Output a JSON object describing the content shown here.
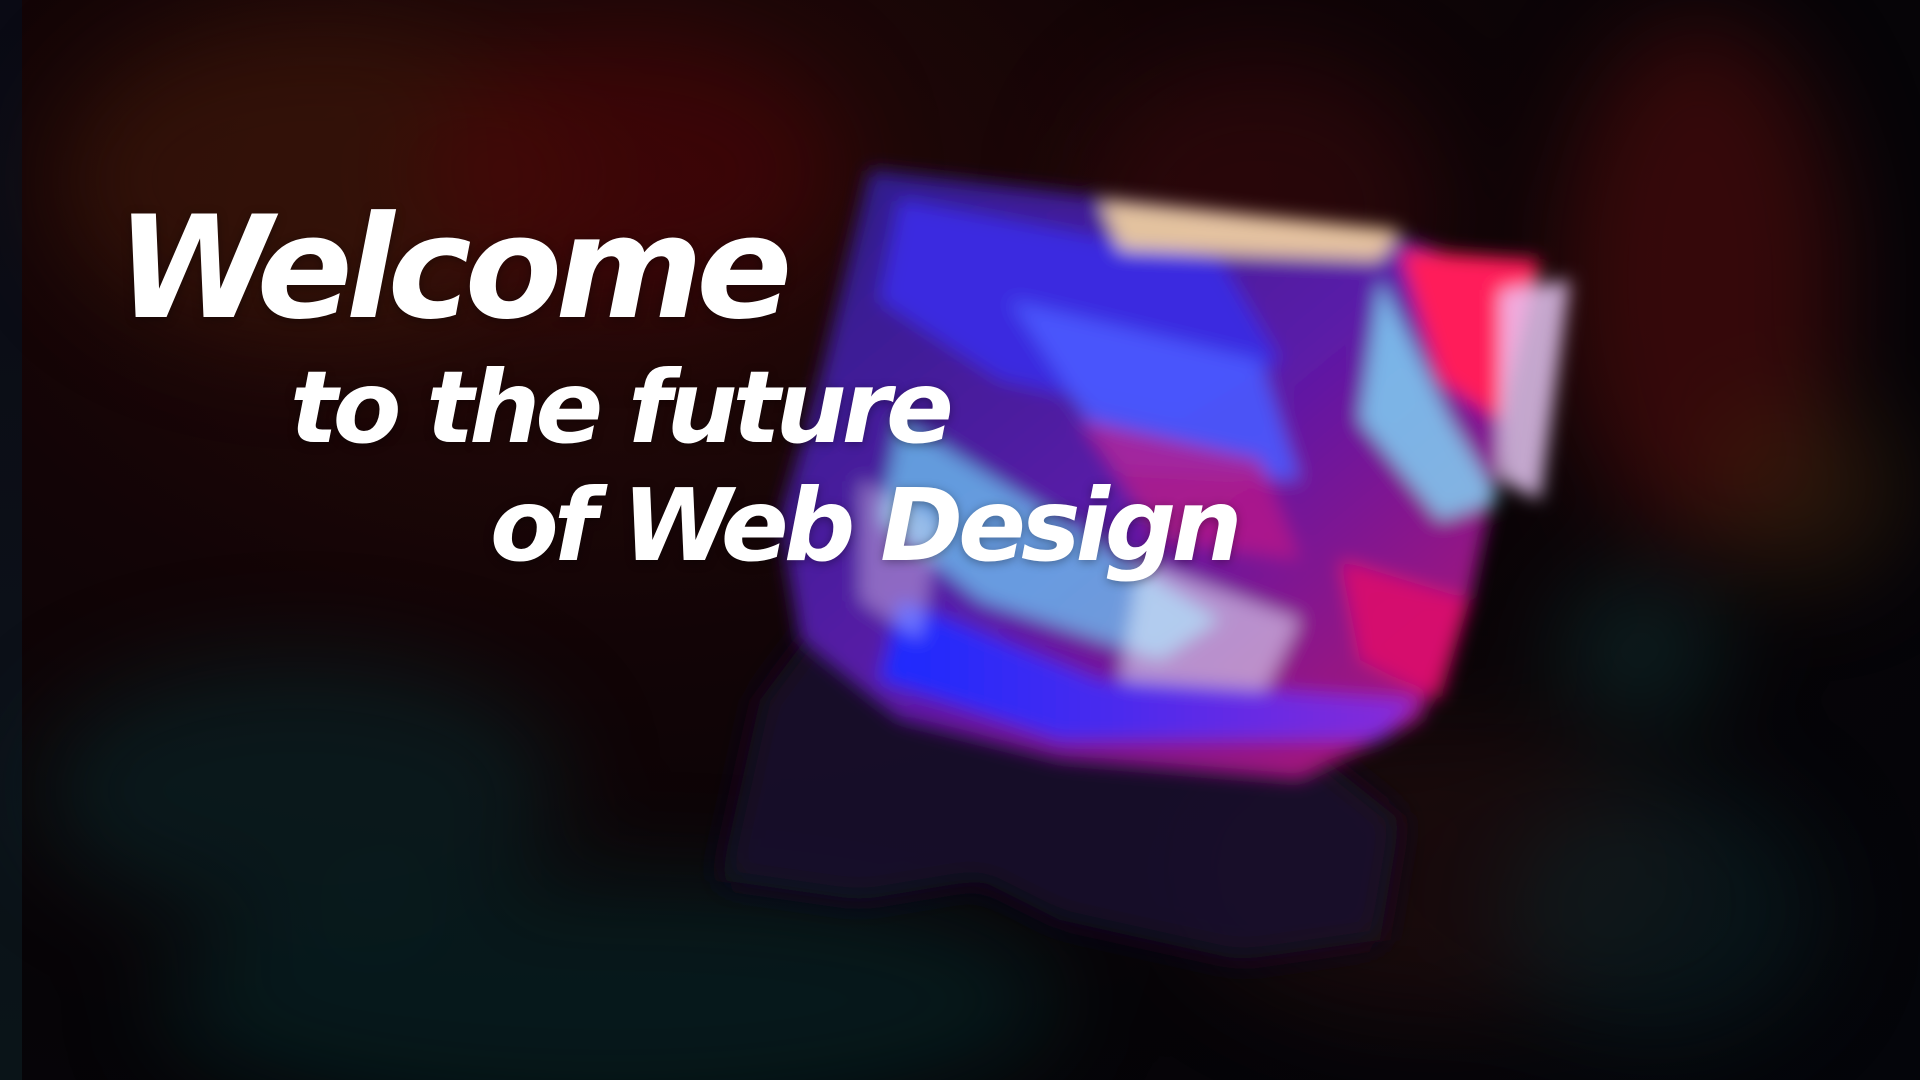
{
  "headline": {
    "line1": "Welcome",
    "line2": "to the future",
    "line3": "of Web Design"
  },
  "colors": {
    "background": "#07050a",
    "text": "#ffffff",
    "accent_magenta": "#e0106a",
    "accent_blue": "#2a3cff",
    "accent_cyan": "#60e0ff",
    "accent_purple": "#6a1aa8"
  }
}
